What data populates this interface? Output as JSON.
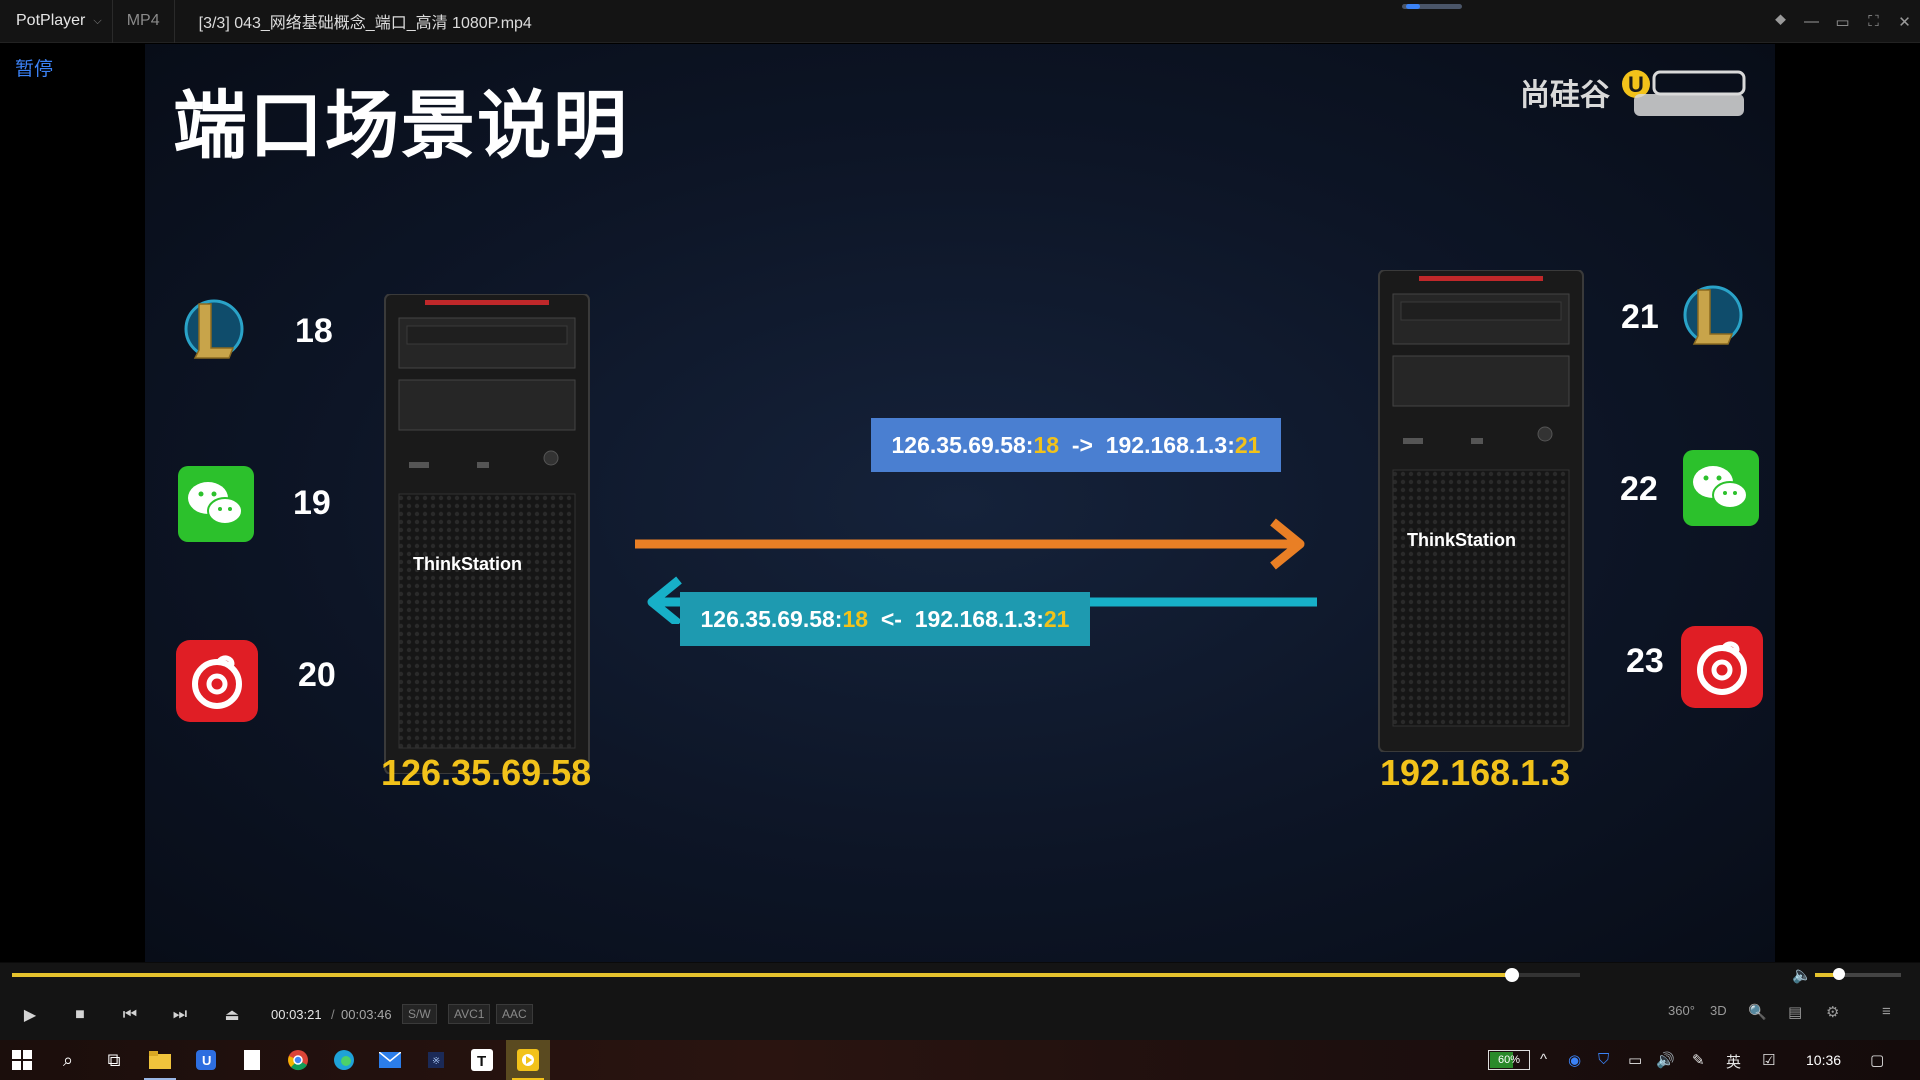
{
  "titlebar": {
    "app_name": "PotPlayer",
    "format": "MP4",
    "file_title": "[3/3] 043_网络基础概念_端口_高清 1080P.mp4"
  },
  "video": {
    "pause_label": "暂停",
    "slide": {
      "title": "端口场景说明",
      "brand_text": "尚硅谷",
      "left_host": {
        "ip": "126.35.69.58",
        "ports": [
          "18",
          "19",
          "20"
        ],
        "tower_label": "ThinkStation"
      },
      "right_host": {
        "ip": "192.168.1.3",
        "ports": [
          "21",
          "22",
          "23"
        ],
        "tower_label": "ThinkStation"
      },
      "request_msg": {
        "src_ip": "126.35.69.58:",
        "src_port": "18",
        "arrow": "  ->  ",
        "dst_ip": "192.168.1.3:",
        "dst_port": "21"
      },
      "response_msg": {
        "src_ip": "126.35.69.58:",
        "src_port": "18",
        "arrow": "  <-  ",
        "dst_ip": "192.168.1.3:",
        "dst_port": "21"
      },
      "colors": {
        "request_arrow": "#e97f25",
        "response_arrow": "#17b0c8",
        "request_box": "#4a7fd1",
        "response_box": "#1e9ab0",
        "highlight": "#f2c21a"
      }
    }
  },
  "controls": {
    "progress": 0.9567,
    "volume": 0.28,
    "time_current": "00:03:21",
    "time_sep": "/",
    "time_total": "00:03:46",
    "tags": [
      "S/W",
      "AVC1",
      "AAC"
    ],
    "right_buttons": [
      "360°",
      "3D"
    ]
  },
  "taskbar": {
    "battery": "60%",
    "ime": "英",
    "clock": "10:36"
  }
}
